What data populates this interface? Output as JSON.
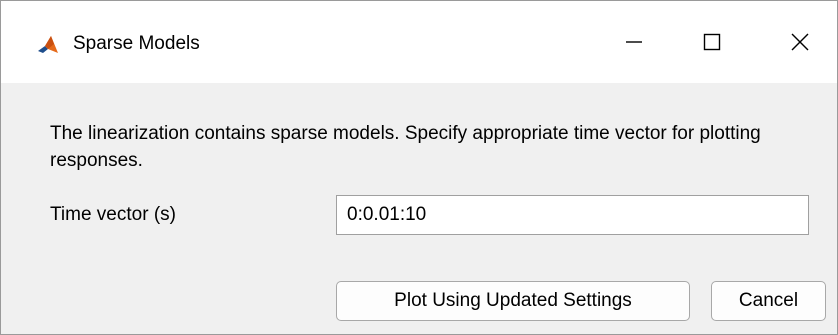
{
  "window": {
    "title": "Sparse Models",
    "icon": "matlab-icon",
    "controls": {
      "minimize": "minimize-icon",
      "maximize": "maximize-icon",
      "close": "close-icon"
    }
  },
  "dialog": {
    "message": "The linearization contains sparse models. Specify appropriate time vector for plotting responses.",
    "time_vector": {
      "label": "Time vector (s)",
      "value": "0:0.01:10"
    },
    "buttons": {
      "plot_label": "Plot Using Updated Settings",
      "cancel_label": "Cancel"
    }
  },
  "colors": {
    "titlebar": "#ffffff",
    "body": "#f0f0f0",
    "matlab_orange": "#e56a1b",
    "matlab_blue": "#1f4e8c"
  }
}
